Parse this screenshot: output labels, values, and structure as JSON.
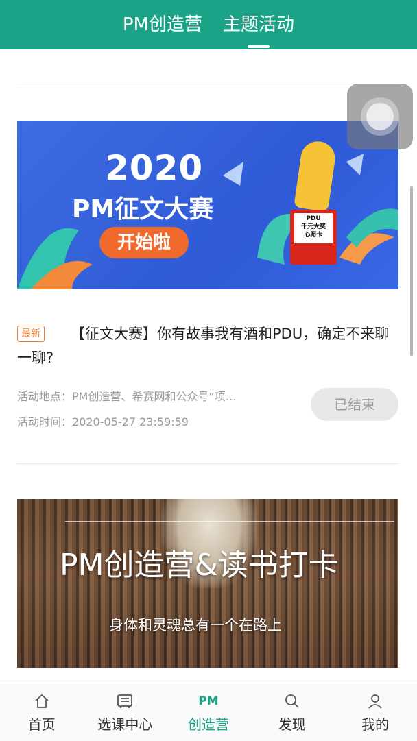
{
  "header": {
    "tabs": [
      {
        "label": "PM创造营",
        "active": false
      },
      {
        "label": "主题活动",
        "active": true
      }
    ]
  },
  "activities": [
    {
      "banner": {
        "year": "2020",
        "title": "PM征文大赛",
        "pill": "开始啦",
        "card_text": "PDU\n千元大奖\n心愿卡"
      },
      "badge": "最新",
      "title": "【征文大赛】你有故事我有酒和PDU，确定不来聊一聊?",
      "location_label": "活动地点：",
      "location": "PM创造营、希赛网和公众号“项…",
      "time_label": "活动时间：",
      "time": "2020-05-27 23:59:59",
      "status": "已结束"
    },
    {
      "banner": {
        "title": "PM创造营&读书打卡",
        "subtitle": "身体和灵魂总有一个在路上"
      }
    }
  ],
  "tabbar": {
    "items": [
      {
        "label": "首页",
        "icon": "home-icon",
        "active": false
      },
      {
        "label": "选课中心",
        "icon": "course-center-icon",
        "active": false
      },
      {
        "label": "创造营",
        "icon": "pm-icon",
        "icon_text": "PM",
        "active": true
      },
      {
        "label": "发现",
        "icon": "search-icon",
        "active": false
      },
      {
        "label": "我的",
        "icon": "user-icon",
        "active": false
      }
    ]
  },
  "colors": {
    "brand": "#1aa387",
    "badge": "#f07a2e",
    "muted": "#9a9a9a"
  }
}
